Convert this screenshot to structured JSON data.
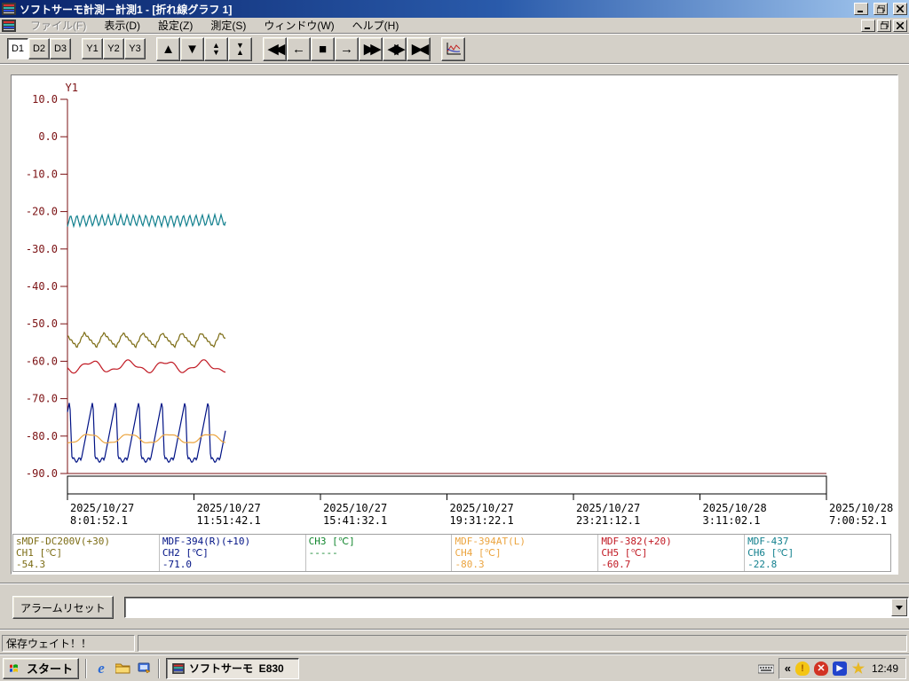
{
  "window": {
    "title": "ソフトサーモ計測－計測1 - [折れ線グラフ 1]"
  },
  "menubar": {
    "items": [
      {
        "label": "ファイル(F)",
        "disabled": true
      },
      {
        "label": "表示(D)",
        "disabled": false
      },
      {
        "label": "設定(Z)",
        "disabled": false
      },
      {
        "label": "測定(S)",
        "disabled": false
      },
      {
        "label": "ウィンドウ(W)",
        "disabled": false
      },
      {
        "label": "ヘルプ(H)",
        "disabled": false
      }
    ]
  },
  "toolbar": {
    "toggles": [
      {
        "label": "D1",
        "active": true,
        "group": 1
      },
      {
        "label": "D2",
        "active": false,
        "group": 1
      },
      {
        "label": "D3",
        "active": false,
        "group": 1
      },
      {
        "label": "Y1",
        "active": false,
        "group": 2
      },
      {
        "label": "Y2",
        "active": false,
        "group": 2
      },
      {
        "label": "Y3",
        "active": false,
        "group": 2
      }
    ],
    "icons": [
      {
        "name": "scroll-up-icon",
        "glyph": "▲",
        "group": 3
      },
      {
        "name": "scroll-down-icon",
        "glyph": "▼",
        "group": 3
      },
      {
        "name": "expand-y-icon",
        "glyph": "▲\n▼",
        "group": 3
      },
      {
        "name": "shrink-y-icon",
        "glyph": "▼\n▲",
        "group": 3
      },
      {
        "name": "rewind-icon",
        "glyph": "◀◀",
        "group": 4
      },
      {
        "name": "step-back-icon",
        "glyph": "←",
        "group": 4
      },
      {
        "name": "stop-icon",
        "glyph": "■",
        "group": 4
      },
      {
        "name": "step-forward-icon",
        "glyph": "→",
        "group": 4
      },
      {
        "name": "fast-forward-icon",
        "glyph": "▶▶",
        "group": 4
      },
      {
        "name": "expand-x-icon",
        "glyph": "◀▶",
        "group": 4
      },
      {
        "name": "shrink-x-icon",
        "glyph": "▶◀",
        "group": 4
      }
    ]
  },
  "chart_data": {
    "type": "line",
    "y_axis": {
      "label": "Y1",
      "max": 10,
      "min": -90,
      "tick_step": 10,
      "tick_labels": [
        "10.0",
        "0.0",
        "-10.0",
        "-20.0",
        "-30.0",
        "-40.0",
        "-50.0",
        "-60.0",
        "-70.0",
        "-80.0",
        "-90.0"
      ],
      "color": "#7b1113"
    },
    "x_axis": {
      "span_hours": 23,
      "tick_labels": [
        [
          "2025/10/27",
          "8:01:52.1"
        ],
        [
          "2025/10/27",
          "11:51:42.1"
        ],
        [
          "2025/10/27",
          "15:41:32.1"
        ],
        [
          "2025/10/27",
          "19:31:22.1"
        ],
        [
          "2025/10/27",
          "23:21:12.1"
        ],
        [
          "2025/10/28",
          "3:11:02.1"
        ],
        [
          "2025/10/28",
          "7:00:52.1"
        ]
      ]
    },
    "series": [
      {
        "channel": "CH6",
        "name": "MDF-437",
        "color": "#12808e",
        "shape": "zigzag",
        "base": -22.4,
        "amp": 1.6,
        "period_hours": 0.19,
        "span_hours": 4.8,
        "phase": 0
      },
      {
        "channel": "CH1",
        "name": "sMDF-DC200V(+30)",
        "color": "#7c6c14",
        "shape": "saw",
        "base": -54.3,
        "amp": 1.9,
        "period_hours": 0.59,
        "span_hours": 4.8,
        "phase": 0.5
      },
      {
        "channel": "CH5",
        "name": "MDF-382(+20)",
        "color": "#c01822",
        "shape": "wave",
        "base": -61.4,
        "amp": 1.3,
        "period_hours": 1.13,
        "span_hours": 4.8,
        "rad": 3.8
      },
      {
        "channel": "CH2",
        "name": "MDF-394(R)(+10)",
        "color": "#001285",
        "shape": "spike",
        "base": -78.6,
        "amp": 8.2,
        "period_hours": 0.7,
        "span_hours": 4.8,
        "phase": 0.42
      },
      {
        "channel": "CH4",
        "name": "MDF-394AT(L)",
        "color": "#eba43f",
        "shape": "sine",
        "base": -80.7,
        "amp": 1.2,
        "period_hours": 1.21,
        "span_hours": 4.8,
        "rad": 4.4
      }
    ]
  },
  "legend": {
    "channels": [
      {
        "name": "sMDF-DC200V(+30)",
        "label": "CH1 [℃]",
        "value": "-54.3",
        "color": "#7c6c14"
      },
      {
        "name": "MDF-394(R)(+10)",
        "label": "CH2 [℃]",
        "value": "-71.0",
        "color": "#001285"
      },
      {
        "name": "",
        "label": "CH3 [℃]",
        "value": "-----",
        "color": "#12862e"
      },
      {
        "name": "MDF-394AT(L)",
        "label": "CH4 [℃]",
        "value": "-80.3",
        "color": "#eba43f"
      },
      {
        "name": "MDF-382(+20)",
        "label": "CH5 [℃]",
        "value": "-60.7",
        "color": "#c01822"
      },
      {
        "name": "MDF-437",
        "label": "CH6 [℃]",
        "value": "-22.8",
        "color": "#12808e"
      }
    ]
  },
  "alarm": {
    "reset_label": "アラームリセット",
    "combo_value": ""
  },
  "statusbar": {
    "message": "保存ウェイト！！"
  },
  "taskbar": {
    "start_label": "スタート",
    "task_label": "ソフトサーモ  E830",
    "clock": "12:49"
  }
}
